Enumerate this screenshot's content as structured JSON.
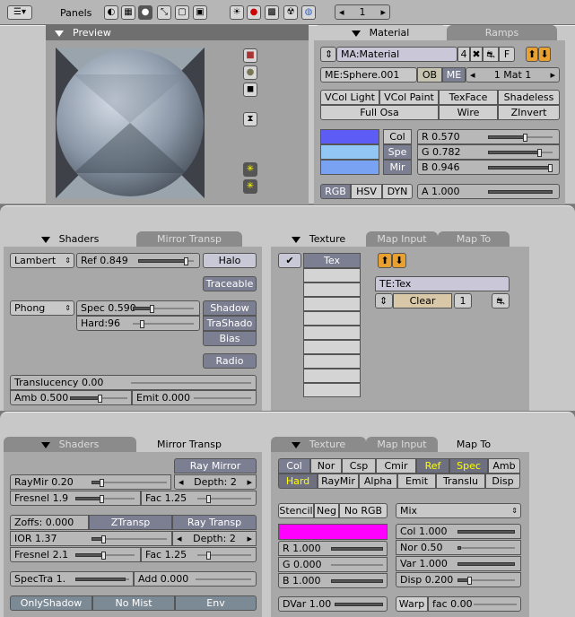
{
  "top": {
    "panels_label": "Panels",
    "frame": "1"
  },
  "preview": {
    "title": "Preview"
  },
  "material": {
    "tab_material": "Material",
    "tab_ramps": "Ramps",
    "ma_name": "MA:Material",
    "users": "4",
    "f_label": "F",
    "me_name": "ME:Sphere.001",
    "ob": "OB",
    "me": "ME",
    "mat_index": "1 Mat 1",
    "toggles": [
      "VCol Light",
      "VCol Paint",
      "TexFace",
      "Shadeless",
      "Full Osa",
      "Wire",
      "ZInvert"
    ],
    "col": "Col",
    "spe": "Spe",
    "mir": "Mir",
    "r": "R 0.570",
    "g": "G 0.782",
    "b": "B 0.946",
    "rgb": "RGB",
    "hsv": "HSV",
    "dyn": "DYN",
    "a": "A 1.000",
    "colors": {
      "col": "#5d5cf4",
      "spe": "#92c6f4",
      "mir": "#79a3f2"
    }
  },
  "shaders": {
    "tab_shaders": "Shaders",
    "tab_mirror": "Mirror Transp",
    "diffuse": "Lambert",
    "ref": "Ref",
    "ref_val": "0.849",
    "halo": "Halo",
    "traceable": "Traceable",
    "specular": "Phong",
    "spec": "Spec 0.590",
    "hard": "Hard:96",
    "shadow": "Shadow",
    "trashado": "TraShado",
    "bias": "Bias",
    "radio": "Radio",
    "translucency": "Translucency 0.00",
    "amb": "Amb 0.500",
    "emit": "Emit 0.000"
  },
  "texture": {
    "tab_texture": "Texture",
    "tab_mapinput": "Map Input",
    "tab_mapto": "Map To",
    "slot1": "Tex",
    "te_name": "TE:Tex",
    "clear": "Clear",
    "users": "1"
  },
  "mirror": {
    "tab_shaders": "Shaders",
    "tab_mirror": "Mirror Transp",
    "ray_mirror": "Ray Mirror",
    "raymir": "RayMir 0.20",
    "depth1": "Depth: 2",
    "fresnel1": "Fresnel 1.9",
    "fac1": "Fac 1.25",
    "zoffs": "Zoffs: 0.000",
    "ztransp": "ZTransp",
    "ray_transp": "Ray Transp",
    "ior": "IOR 1.37",
    "depth2": "Depth: 2",
    "fresnel2": "Fresnel 2.1",
    "fac2": "Fac 1.25",
    "spectra": "SpecTra 1.",
    "add": "Add 0.000",
    "onlyshadow": "OnlyShadow",
    "nomist": "No Mist",
    "env": "Env"
  },
  "mapto": {
    "tab_texture": "Texture",
    "tab_mapinput": "Map Input",
    "tab_mapto": "Map To",
    "row1": [
      "Col",
      "Nor",
      "Csp",
      "Cmir",
      "Ref",
      "Spec",
      "Amb"
    ],
    "row2": [
      "Hard",
      "RayMir",
      "Alpha",
      "Emit",
      "Translu",
      "Disp"
    ],
    "stencil": "Stencil",
    "neg": "Neg",
    "norgb": "No RGB",
    "blend": "Mix",
    "r": "R 1.000",
    "g": "G 0.000",
    "b": "B 1.000",
    "col": "Col 1.000",
    "nor": "Nor 0.50",
    "var": "Var 1.000",
    "disp": "Disp 0.200",
    "dvar": "DVar 1.00",
    "warp": "Warp",
    "fac": "fac 0.00",
    "swatch": "#ff00ff"
  }
}
